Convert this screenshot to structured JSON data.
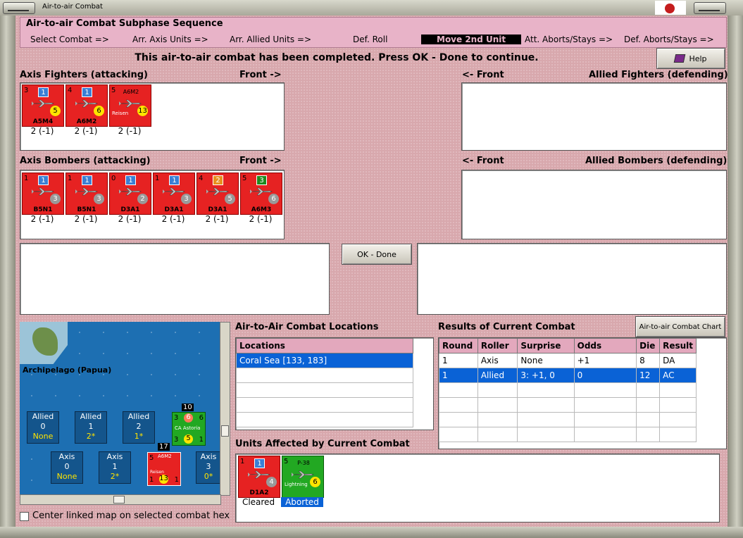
{
  "window": {
    "title": "Air-to-air Combat"
  },
  "sequence": {
    "heading": "Air-to-air Combat Subphase Sequence",
    "steps": [
      "Select Combat =>",
      "Arr. Axis Units =>",
      "Arr. Allied Units =>",
      "Def. Roll",
      "Move 2nd Unit",
      "Att. Aborts/Stays =>",
      "Def. Aborts/Stays =>"
    ],
    "active_index": 4
  },
  "message": "This air-to-air combat has been completed.  Press OK - Done to continue.",
  "help_label": "Help",
  "axis_fighters": {
    "label": "Axis Fighters (attacking)",
    "front": "Front ->",
    "units": [
      {
        "tl": "3",
        "badge": "1",
        "circle": "5",
        "name": "A5M4",
        "stat": "2 (-1)"
      },
      {
        "tl": "4",
        "badge": "1",
        "circle": "6",
        "name": "A6M2",
        "stat": "2 (-1)"
      },
      {
        "tl": "5",
        "badge": "A6M2",
        "circle": "13",
        "name": "",
        "sub": "Reisen",
        "stat": "2 (-1)"
      }
    ]
  },
  "allied_fighters": {
    "label": "Allied Fighters (defending)",
    "front": "<- Front"
  },
  "axis_bombers": {
    "label": "Axis Bombers (attacking)",
    "front": "Front ->",
    "units": [
      {
        "tl": "1",
        "badge": "1",
        "circle": "3",
        "name": "B5N1",
        "stat": "2 (-1)"
      },
      {
        "tl": "1",
        "badge": "1",
        "circle": "3",
        "name": "B5N1",
        "stat": "2 (-1)"
      },
      {
        "tl": "0",
        "badge": "1",
        "circle": "2",
        "name": "D3A1",
        "stat": "2 (-1)"
      },
      {
        "tl": "1",
        "badge": "1",
        "circle": "3",
        "name": "D3A1",
        "stat": "2 (-1)"
      },
      {
        "tl": "4",
        "badge": "2",
        "circle": "5",
        "name": "D3A1",
        "stat": "2 (-1)"
      },
      {
        "tl": "5",
        "badge": "3",
        "circle": "6",
        "name": "A6M3",
        "stat": "2 (-1)"
      }
    ]
  },
  "allied_bombers": {
    "label": "Allied Bombers (defending)",
    "front": "<- Front"
  },
  "ok_label": "OK - Done",
  "map": {
    "region": "Archipelago (Papua)",
    "allied_boxes": [
      {
        "label": "Allied",
        "num": "0",
        "sub": "None"
      },
      {
        "label": "Allied",
        "num": "1",
        "sub": "2*"
      },
      {
        "label": "Allied",
        "num": "2",
        "sub": "1*"
      }
    ],
    "axis_boxes": [
      {
        "label": "Axis",
        "num": "0",
        "sub": "None"
      },
      {
        "label": "Axis",
        "num": "1",
        "sub": "2*"
      },
      {
        "label": "Axis",
        "num": "3",
        "sub": "0*"
      }
    ],
    "stack_counts": [
      "10",
      "17"
    ],
    "ship": {
      "name": "CA Astoria",
      "left": "3",
      "right": "6",
      "circle_top": "6",
      "circle_bottom": "5",
      "bl": "3",
      "br": "1"
    },
    "plane": {
      "name": "A6M2",
      "sub": "Reisen",
      "circle": "13",
      "tl": "5",
      "bl": "1",
      "br": "1"
    }
  },
  "center_checkbox": "Center linked map on selected combat hex",
  "locations": {
    "title": "Air-to-Air Combat Locations",
    "column": "Locations",
    "rows": [
      "Coral Sea [133, 183]"
    ]
  },
  "results": {
    "title": "Results of Current Combat",
    "chart_button": "Air-to-air Combat Chart",
    "columns": [
      "Round",
      "Roller",
      "Surprise",
      "Odds",
      "Die",
      "Result"
    ],
    "rows": [
      [
        "1",
        "Axis",
        "None",
        "+1",
        "8",
        "DA"
      ],
      [
        "1",
        "Allied",
        "3: +1, 0",
        "0",
        "12",
        "AC"
      ]
    ],
    "selected_row": 1
  },
  "affected": {
    "title": "Units Affected by Current Combat",
    "units": [
      {
        "tl": "1",
        "badge": "1",
        "circle": "4",
        "name": "D1A2",
        "status": "Cleared",
        "color": "red"
      },
      {
        "tl": "5",
        "badge": "P-38",
        "circle": "6",
        "name": "",
        "sub": "Lightning",
        "status": "Aborted",
        "color": "green"
      }
    ]
  },
  "colors": {
    "accent": "#0a62d6",
    "axis_red": "#e62222",
    "allied_green": "#22a822",
    "panel_pink": "#e8b3c8"
  },
  "icons": [
    "help-book-icon",
    "rising-sun-flag-icon",
    "plane-icon",
    "ship-icon",
    "scroll-arrow-icon"
  ]
}
